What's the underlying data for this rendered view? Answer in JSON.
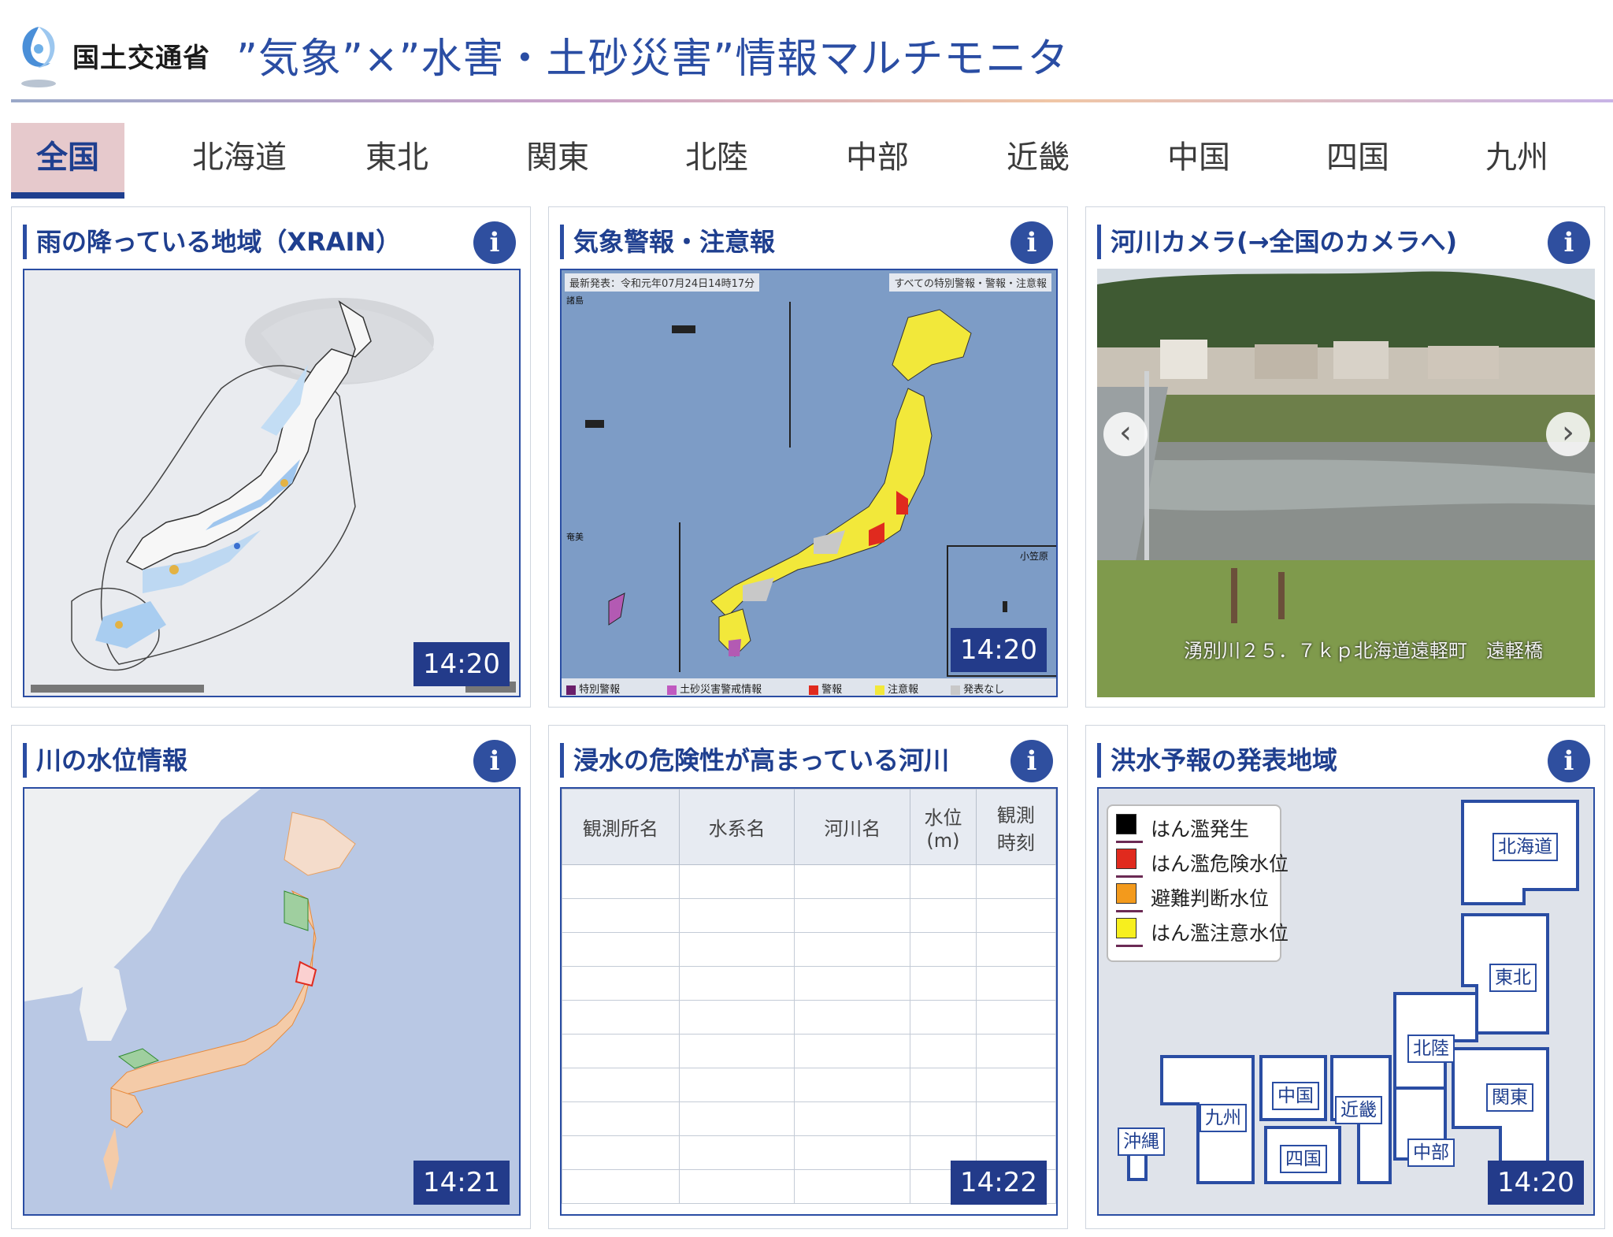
{
  "header": {
    "ministry": "国土交通省",
    "title": "”気象”×”水害・土砂災害”情報マルチモニタ",
    "logo_icon": "mlit-logo-icon"
  },
  "tabs": [
    {
      "label": "全国",
      "active": true
    },
    {
      "label": "北海道"
    },
    {
      "label": "東北"
    },
    {
      "label": "関東"
    },
    {
      "label": "北陸"
    },
    {
      "label": "中部"
    },
    {
      "label": "近畿"
    },
    {
      "label": "中国"
    },
    {
      "label": "四国"
    },
    {
      "label": "九州"
    }
  ],
  "panels": {
    "rain": {
      "title": "雨の降っている地域（XRAIN）",
      "time": "14:20"
    },
    "warnings": {
      "title": "気象警報・注意報",
      "time": "14:20",
      "map_header_left": "最新発表：令和元年07月24日14時17分",
      "map_header_right": "すべての特別警報・警報・注意報",
      "inset_label": "小笠原",
      "label_north": "諸島",
      "label_south": "奄美",
      "legend": [
        "特別警報",
        "土砂災害警戒情報",
        "警報",
        "注意報",
        "発表なし"
      ]
    },
    "camera": {
      "title": "河川カメラ(→全国のカメラへ)",
      "caption": "湧別川２５．７ｋｐ北海道遠軽町　遠軽橋",
      "prev_icon": "chevron-left-icon",
      "next_icon": "chevron-right-icon"
    },
    "water_level": {
      "title": "川の水位情報",
      "time": "14:21"
    },
    "flood_risk": {
      "title": "浸水の危険性が高まっている河川",
      "time": "14:22",
      "columns": [
        "観測所名",
        "水系名",
        "河川名",
        "水位\n(m)",
        "観測\n時刻"
      ]
    },
    "flood_forecast": {
      "title": "洪水予報の発表地域",
      "time": "14:20",
      "legend": [
        {
          "label": "はん濫発生",
          "color": "#000000"
        },
        {
          "label": "はん濫危険水位",
          "color": "#e02a1e"
        },
        {
          "label": "避難判断水位",
          "color": "#f39a1c"
        },
        {
          "label": "はん濫注意水位",
          "color": "#f7ef1e"
        }
      ],
      "regions": [
        "北海道",
        "東北",
        "北陸",
        "関東",
        "中部",
        "近畿",
        "中国",
        "四国",
        "九州",
        "沖縄"
      ]
    }
  },
  "colors": {
    "accent": "#2a4da3",
    "badge": "#233b8a",
    "tab_active_bg": "#e6c9cc"
  }
}
